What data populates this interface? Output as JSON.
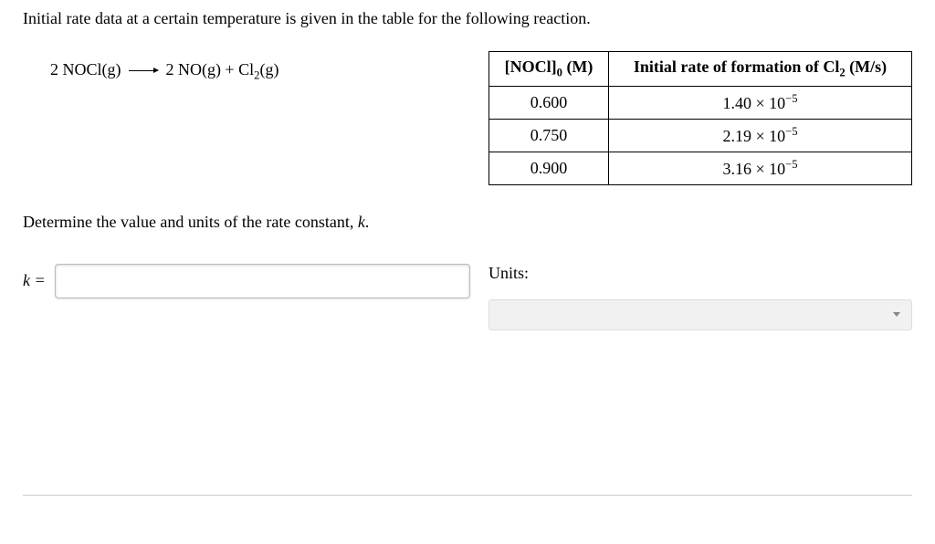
{
  "intro": "Initial rate data at a certain temperature is given in the table for the following reaction.",
  "equation": {
    "lhs_coef": "2",
    "lhs_species": "NOCl(g)",
    "rhs1_coef": "2",
    "rhs1_species": "NO(g)",
    "plus": " + ",
    "rhs2_species_pre": "Cl",
    "rhs2_sub": "2",
    "rhs2_species_post": "(g)"
  },
  "table": {
    "header1_pre": "[NOCl]",
    "header1_sub": "0",
    "header1_post": " (M)",
    "header2_pre": "Initial rate of formation of Cl",
    "header2_sub": "2",
    "header2_post": " (M/s)",
    "rows": [
      {
        "conc": "0.600",
        "rate_base": "1.40 × 10",
        "rate_exp": "−5"
      },
      {
        "conc": "0.750",
        "rate_base": "2.19 × 10",
        "rate_exp": "−5"
      },
      {
        "conc": "0.900",
        "rate_base": "3.16 × 10",
        "rate_exp": "−5"
      }
    ]
  },
  "prompt2_pre": "Determine the value and units of the rate constant, ",
  "prompt2_k": "k",
  "prompt2_post": ".",
  "k_label_pre": "k",
  "k_label_post": " =",
  "units_label": "Units:",
  "k_value": "",
  "units_value": ""
}
